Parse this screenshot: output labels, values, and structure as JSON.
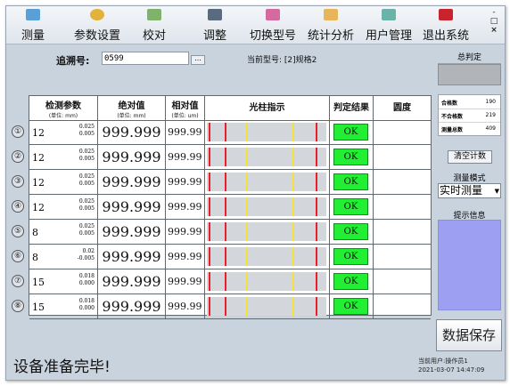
{
  "toolbar": {
    "items": [
      {
        "label": "测量",
        "icon": "measure-icon"
      },
      {
        "label": "参数设置",
        "icon": "settings-icon"
      },
      {
        "label": "校对",
        "icon": "calibrate-icon"
      },
      {
        "label": "调整",
        "icon": "adjust-icon"
      },
      {
        "label": "切换型号",
        "icon": "switch-model-icon"
      },
      {
        "label": "统计分析",
        "icon": "statistics-icon"
      },
      {
        "label": "用户管理",
        "icon": "users-icon"
      },
      {
        "label": "退出系统",
        "icon": "exit-icon"
      }
    ],
    "window_minimize": "-",
    "window_restore": "□",
    "window_close": "×"
  },
  "trace": {
    "label": "追溯号:",
    "value": "0599",
    "browse_button": "..."
  },
  "current_model": "当前型号: [2]规格2",
  "table": {
    "headers": {
      "param": "检测参数",
      "param_unit": "(单位: mm)",
      "abs": "绝对值",
      "abs_unit": "(单位: mm)",
      "rel": "相对值",
      "rel_unit": "(单位: um)",
      "bar": "光柱指示",
      "result": "判定结果",
      "roundness": "圆度"
    },
    "rows": [
      {
        "num": "①",
        "nominal": "12",
        "tol_upper": "0.025",
        "tol_lower": "0.005",
        "abs": "999.999",
        "rel": "999.99",
        "result": "OK",
        "roundness": ""
      },
      {
        "num": "②",
        "nominal": "12",
        "tol_upper": "0.025",
        "tol_lower": "0.005",
        "abs": "999.999",
        "rel": "999.99",
        "result": "OK",
        "roundness": ""
      },
      {
        "num": "③",
        "nominal": "12",
        "tol_upper": "0.025",
        "tol_lower": "0.005",
        "abs": "999.999",
        "rel": "999.99",
        "result": "OK",
        "roundness": ""
      },
      {
        "num": "④",
        "nominal": "12",
        "tol_upper": "0.025",
        "tol_lower": "0.005",
        "abs": "999.999",
        "rel": "999.99",
        "result": "OK",
        "roundness": ""
      },
      {
        "num": "⑤",
        "nominal": "8",
        "tol_upper": "0.025",
        "tol_lower": "0.005",
        "abs": "999.999",
        "rel": "999.99",
        "result": "OK",
        "roundness": ""
      },
      {
        "num": "⑥",
        "nominal": "8",
        "tol_upper": "0.02",
        "tol_lower": "-0.005",
        "abs": "999.999",
        "rel": "999.99",
        "result": "OK",
        "roundness": ""
      },
      {
        "num": "⑦",
        "nominal": "15",
        "tol_upper": "0.018",
        "tol_lower": "0.000",
        "abs": "999.999",
        "rel": "999.99",
        "result": "OK",
        "roundness": ""
      },
      {
        "num": "⑧",
        "nominal": "15",
        "tol_upper": "0.018",
        "tol_lower": "0.000",
        "abs": "999.999",
        "rel": "999.99",
        "result": "OK",
        "roundness": ""
      }
    ]
  },
  "right_panel": {
    "overall_judgement": "总判定",
    "stats": [
      {
        "label": "合格数",
        "value": "190"
      },
      {
        "label": "不合格数",
        "value": "219"
      },
      {
        "label": "测量总数",
        "value": "409"
      }
    ],
    "clear_button": "清空计数",
    "mode_label": "测量模式",
    "mode_value": "实时测量",
    "hint_label": "提示信息",
    "save_button": "数据保存"
  },
  "status": {
    "message": "设备准备完毕!",
    "user": "当前用户:操作员1",
    "datetime": "2021-03-07 14:47:09"
  },
  "colors": {
    "ok_green": "#22ee33",
    "limit_red": "#e8202a",
    "limit_yellow": "#f3e23a",
    "hint_purple": "#9d9ff2",
    "background": "#c9d3de"
  }
}
